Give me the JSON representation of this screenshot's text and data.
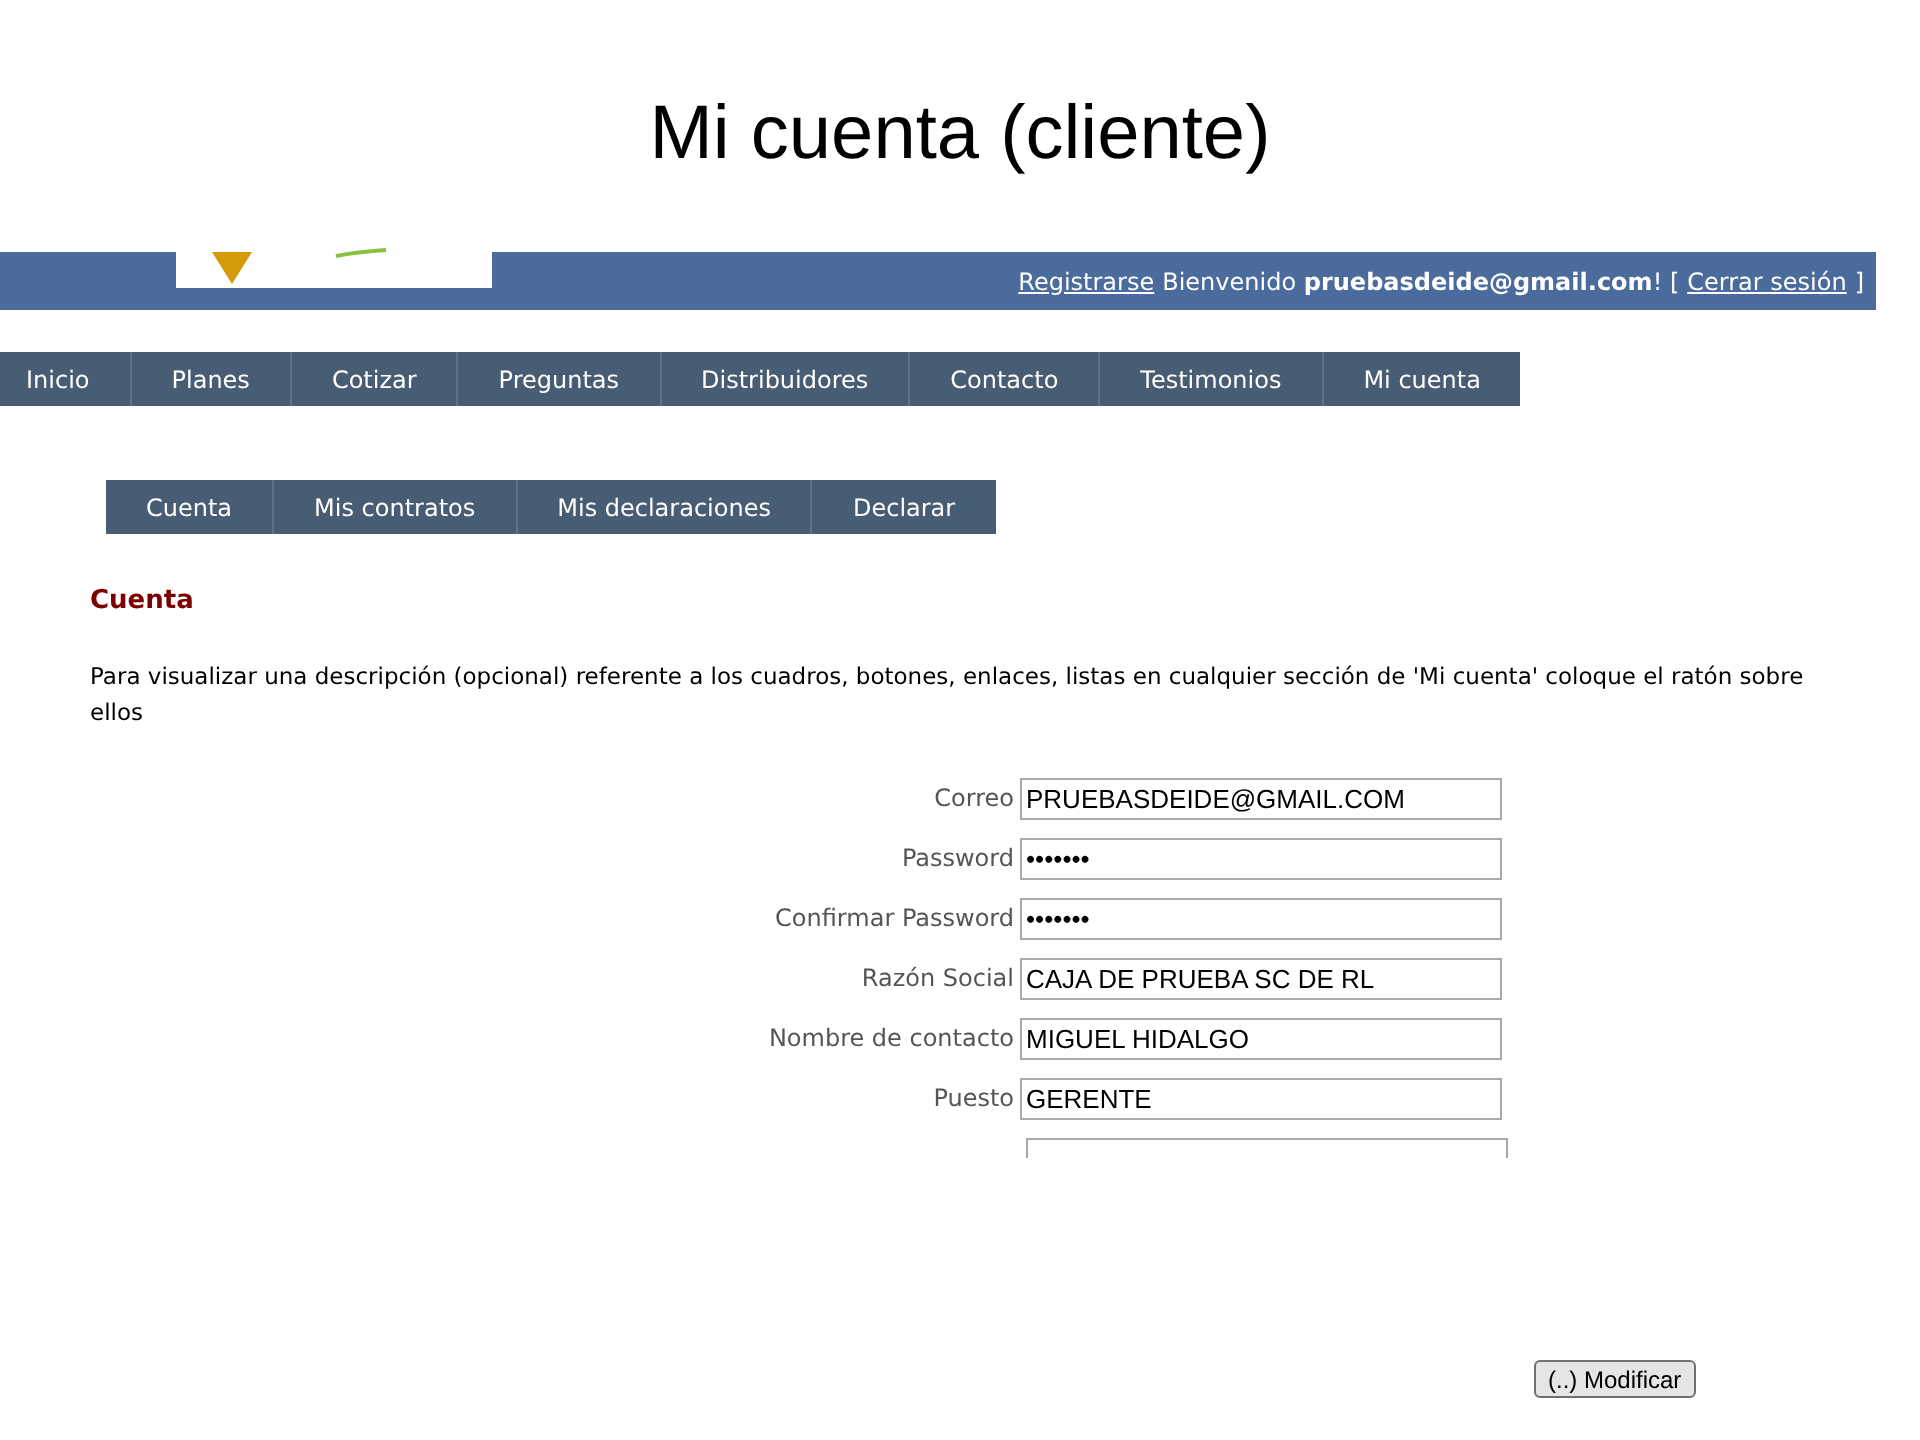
{
  "slide_title": "Mi cuenta (cliente)",
  "header": {
    "register_link": "Registrarse",
    "welcome": "Bienvenido **pruebasdeide@gmail.com**! [",
    "logout_link": "Cerrar sesión",
    "closing": "]"
  },
  "main_nav": [
    "Inicio",
    "Planes",
    "Cotizar",
    "Preguntas",
    "Distribuidores",
    "Contacto",
    "Testimonios",
    "Mi cuenta"
  ],
  "sub_nav": [
    "Cuenta",
    "Mis contratos",
    "Mis declaraciones",
    "Declarar"
  ],
  "section_title": "Cuenta",
  "description": "Para visualizar una descripción (opcional) referente a los cuadros, botones, enlaces, listas en cualquier sección de 'Mi cuenta' coloque el ratón sobre ellos",
  "fields": [
    {
      "label": "Correo",
      "value": "PRUEBASDEIDE@GMAIL.COM"
    },
    {
      "label": "Password",
      "value": "•••••••"
    },
    {
      "label": "Confirmar Password",
      "value": "•••••••"
    },
    {
      "label": "Razón Social",
      "value": "CAJA DE PRUEBA SC DE RL"
    },
    {
      "label": "Nombre de contacto",
      "value": "MIGUEL HIDALGO"
    },
    {
      "label": "Puesto",
      "value": "GERENTE"
    }
  ],
  "submit_button": "(..) Modificar"
}
